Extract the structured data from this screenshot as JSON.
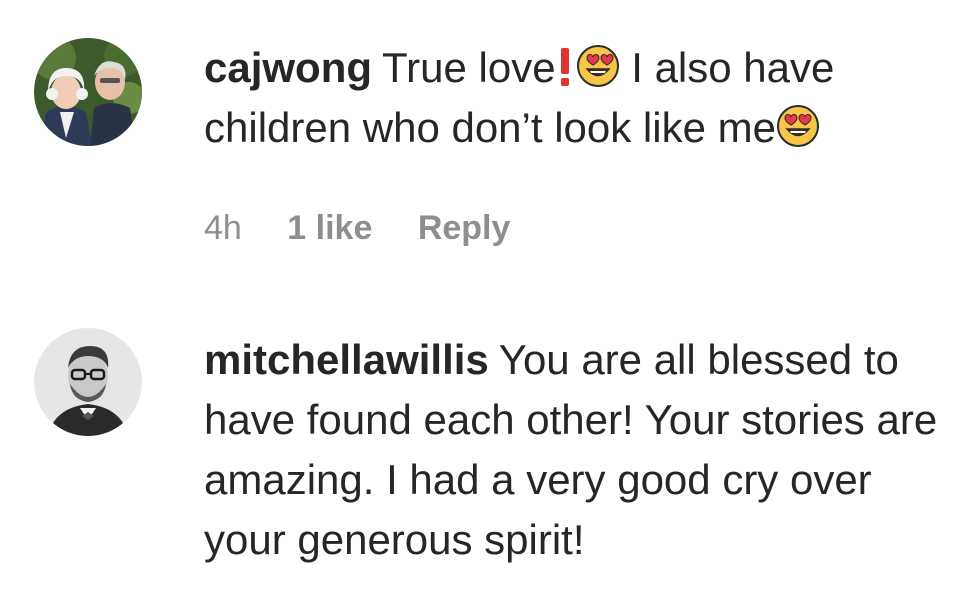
{
  "comments": [
    {
      "username": "cajwong",
      "text_part1": "True love",
      "text_part2": " I also have children who don’t look like me",
      "icons": [
        "exclamation-icon",
        "heart-eyes-emoji-icon"
      ],
      "time": "4h",
      "likes": "1 like",
      "reply_label": "Reply"
    },
    {
      "username": "mitchellawillis",
      "text": "You are all blessed to have found each other! Your stories are amazing. I had a very good cry over your generous spirit!"
    }
  ],
  "colors": {
    "text": "#262626",
    "muted": "#8e8e8e",
    "emoji_face": "#f7c648",
    "emoji_heart": "#e8374a",
    "exclamation": "#e0342e"
  }
}
